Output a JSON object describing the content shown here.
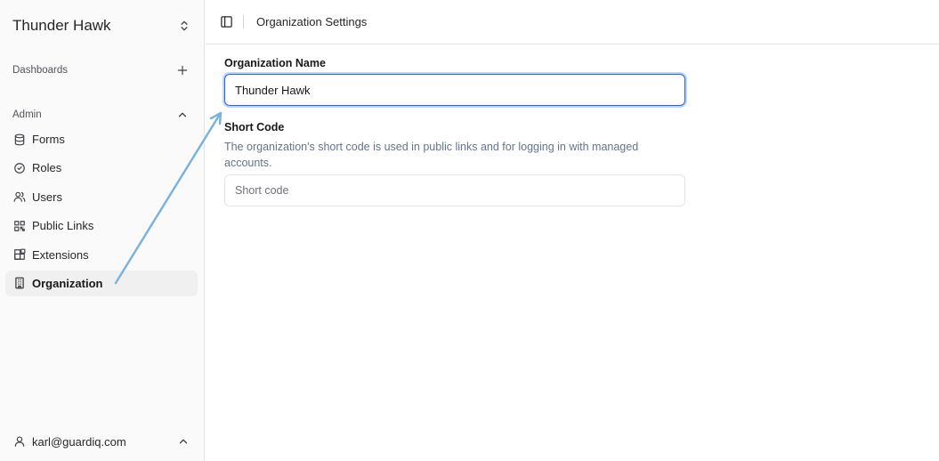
{
  "sidebar": {
    "org_name": "Thunder Hawk",
    "groups": {
      "dashboards": "Dashboards",
      "admin": "Admin"
    },
    "items": [
      {
        "label": "Forms",
        "icon": "database-icon"
      },
      {
        "label": "Roles",
        "icon": "check-circle-icon"
      },
      {
        "label": "Users",
        "icon": "users-icon"
      },
      {
        "label": "Public Links",
        "icon": "qr-code-icon"
      },
      {
        "label": "Extensions",
        "icon": "blocks-icon"
      },
      {
        "label": "Organization",
        "icon": "building-icon",
        "active": true
      }
    ],
    "user_email": "karl@guardiq.com"
  },
  "header": {
    "title": "Organization Settings"
  },
  "form": {
    "org_name_label": "Organization Name",
    "org_name_value": "Thunder Hawk",
    "short_code_label": "Short Code",
    "short_code_help": "The organization's short code is used in public links and for logging in with managed accounts.",
    "short_code_placeholder": "Short code",
    "short_code_value": ""
  },
  "colors": {
    "accent": "#2563eb",
    "annotation_arrow": "#7ab3de",
    "sidebar_bg": "#fafafa"
  }
}
